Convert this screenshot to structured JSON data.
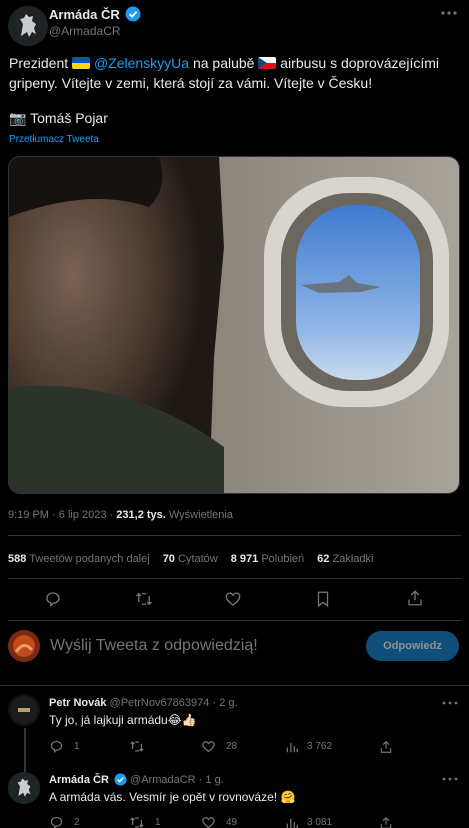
{
  "main_tweet": {
    "author_name": "Armáda ČR",
    "author_handle": "@ArmadaCR",
    "text_part1": "Prezident",
    "mention": "@ZelenskyyUa",
    "text_part2": "na palubě",
    "text_part3": "airbusu s doprovázejícími gripeny. Vítejte v zemi, která stojí za vámi. Vítejte v Česku!",
    "photo_credit": "Tomáš Pojar",
    "translate_label": "Przetłumacz Tweeta",
    "time": "9:19 PM",
    "date": "6 lip 2023",
    "views_count": "231,2 tys.",
    "views_label": "Wyświetlenia",
    "stats": {
      "retweets_count": "588",
      "retweets_label": "Tweetów podanych dalej",
      "quotes_count": "70",
      "quotes_label": "Cytatów",
      "likes_count": "8 971",
      "likes_label": "Polubień",
      "bookmarks_count": "62",
      "bookmarks_label": "Zakładki"
    }
  },
  "reply_composer": {
    "placeholder": "Wyślij Tweeta z odpowiedzią!",
    "button_label": "Odpowiedz"
  },
  "replies": [
    {
      "author_name": "Petr Novák",
      "author_handle": "@PetrNov67863974",
      "dot": "·",
      "time": "2 g.",
      "text": "Ty jo, já lajkuji armádu😂👍🏻",
      "replies": "1",
      "retweets": "",
      "likes": "28",
      "views": "3 762"
    },
    {
      "author_name": "Armáda ČR",
      "author_handle": "@ArmadaCR",
      "dot": "·",
      "time": "1 g.",
      "text": "A armáda vás. Vesmír je opět v rovnováze! 🤗",
      "replies": "2",
      "retweets": "1",
      "likes": "49",
      "views": "3 081"
    }
  ],
  "colors": {
    "accent": "#1d9bf0",
    "background": "#000000",
    "muted": "#71767b",
    "border": "#2f3336",
    "button_bg": "#0f4e78"
  }
}
